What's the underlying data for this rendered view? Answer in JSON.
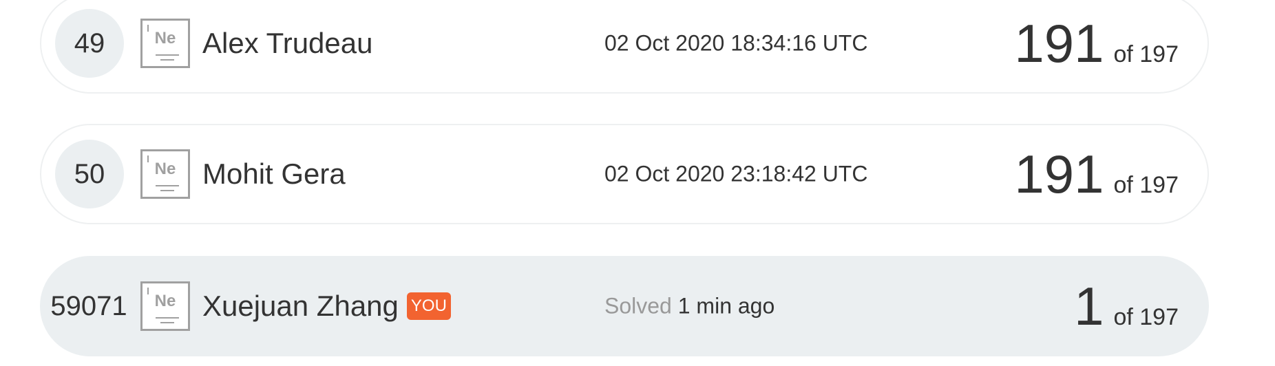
{
  "rows": [
    {
      "rank": "49",
      "badge_symbol": "Ne",
      "name": "Alex Trudeau",
      "time": "02 Oct 2020 18:34:16 UTC",
      "score": "191",
      "of_total": "of 197"
    },
    {
      "rank": "50",
      "badge_symbol": "Ne",
      "name": "Mohit Gera",
      "time": "02 Oct 2020 23:18:42 UTC",
      "score": "191",
      "of_total": "of 197"
    },
    {
      "rank": "59071",
      "badge_symbol": "Ne",
      "name": "Xuejuan Zhang",
      "you_label": "YOU",
      "solved_label": "Solved",
      "solved_ago": "1 min ago",
      "score": "1",
      "of_total": "of 197",
      "highlight_color": "#ebeff1"
    }
  ],
  "colors": {
    "you_badge": "#f26330",
    "rank_circle": "#ebeff1",
    "muted_text": "#999999",
    "badge_outline": "#a0a0a0"
  },
  "icons": {
    "element_badge": "element-badge-icon"
  }
}
